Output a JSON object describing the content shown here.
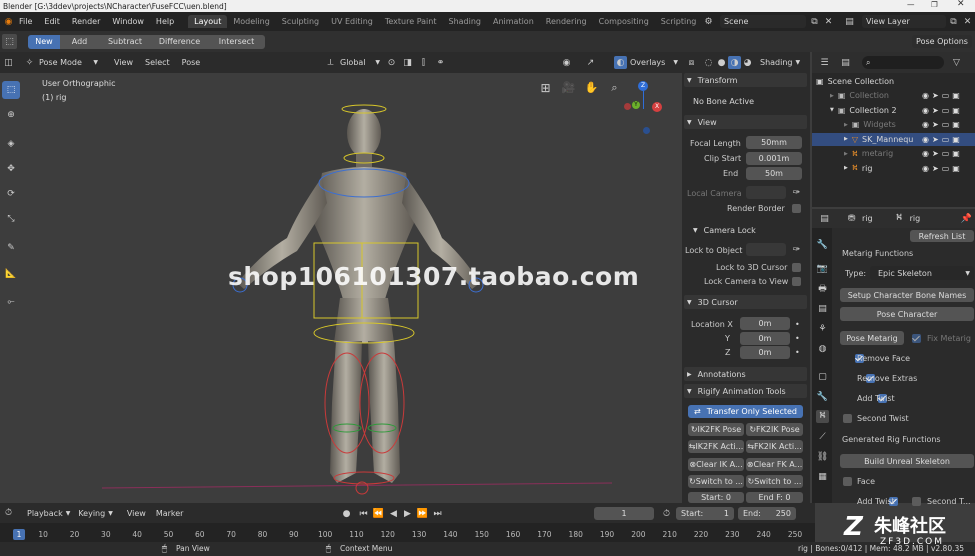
{
  "title": "Blender [G:\\3ddev\\projects\\NCharacter\\FuseFCC\\uen.blend]",
  "menu": [
    "File",
    "Edit",
    "Render",
    "Window",
    "Help"
  ],
  "workspaces": [
    "Layout",
    "Modeling",
    "Sculpting",
    "UV Editing",
    "Texture Paint",
    "Shading",
    "Animation",
    "Rendering",
    "Compositing",
    "Scripting"
  ],
  "scene": "Scene",
  "view_layer": "View Layer",
  "toolbar2": {
    "new": "New",
    "add": "Add",
    "subtract": "Subtract",
    "difference": "Difference",
    "intersect": "Intersect",
    "pose_options": "Pose Options"
  },
  "vp_header": {
    "mode": "Pose Mode",
    "view": "View",
    "select": "Select",
    "pose": "Pose",
    "orientation": "Global",
    "overlays": "Overlays",
    "shading": "Shading"
  },
  "viewport": {
    "line1": "User Orthographic",
    "line2": "(1) rig",
    "watermark": "shop106101307.taobao.com"
  },
  "gizmo": {
    "z": "Z",
    "y": "Y",
    "x": "X"
  },
  "npanel": {
    "transform": "Transform",
    "no_bone": "No Bone Active",
    "view": "View",
    "focal_label": "Focal Length",
    "focal_val": "50mm",
    "clip_start_label": "Clip Start",
    "clip_start_val": "0.001m",
    "end_label": "End",
    "end_val": "50m",
    "local_camera": "Local Camera",
    "render_border": "Render Border",
    "camera_lock": "Camera Lock",
    "lock_object": "Lock to Object",
    "lock_cursor": "Lock to 3D Cursor",
    "lock_camera": "Lock Camera to View",
    "cursor": "3D Cursor",
    "loc_x": "Location X",
    "y": "Y",
    "z": "Z",
    "val_x": "0m",
    "val_y": "0m",
    "val_z": "0m",
    "annotations": "Annotations",
    "rigify": "Rigify Animation Tools",
    "transfer": "Transfer Only Selected",
    "ik2fk_pose": "IK2FK Pose",
    "fk2ik_pose": "FK2IK Pose",
    "ik2fk_act": "IK2FK Acti...",
    "fk2ik_act": "FK2IK Acti...",
    "clear_ik": "Clear IK A...",
    "clear_fk": "Clear FK A...",
    "switch1": "Switch to ...",
    "switch2": "Switch to ...",
    "start": "Start: 0",
    "endf": "End F: 0"
  },
  "outliner": {
    "scene_collection": "Scene Collection",
    "items": [
      {
        "label": "Collection"
      },
      {
        "label": "Collection 2"
      },
      {
        "label": "Widgets"
      },
      {
        "label": "SK_Mannequ"
      },
      {
        "label": "metarig"
      },
      {
        "label": "rig"
      }
    ]
  },
  "props": {
    "breadcrumb1": "rig",
    "breadcrumb2": "rig",
    "refresh": "Refresh List",
    "metarig_functions": "Metarig Functions",
    "type_label": "Type:",
    "type_val": "Epic Skeleton",
    "setup": "Setup Character Bone Names",
    "pose_char": "Pose Character",
    "pose_metarig": "Pose Metarig",
    "fix_metarig": "Fix Metarig",
    "remove_face": "Remove Face",
    "remove_extras": "Remove Extras",
    "add_twist": "Add Twist",
    "second_twist": "Second Twist",
    "generated": "Generated Rig Functions",
    "build": "Build Unreal Skeleton",
    "face": "Face",
    "add_twist2": "Add Twist",
    "second_t": "Second T..."
  },
  "timeline": {
    "playback": "Playback",
    "keying": "Keying",
    "view": "View",
    "marker": "Marker",
    "current": "1",
    "start_label": "Start:",
    "start": "1",
    "end_label": "End:",
    "end": "250",
    "ticks": [
      "1",
      "10",
      "20",
      "30",
      "40",
      "50",
      "60",
      "70",
      "80",
      "90",
      "100",
      "110",
      "120",
      "130",
      "140",
      "150",
      "160",
      "170",
      "180",
      "190",
      "200",
      "210",
      "220",
      "230",
      "240",
      "250"
    ]
  },
  "status": {
    "pan": "Pan View",
    "context": "Context Menu",
    "info": "rig | Bones:0/412 | Mem: 48.2 MB | v2.80.35"
  },
  "logo": {
    "text": "朱峰社区",
    "sub": "ZF3D.COM"
  }
}
